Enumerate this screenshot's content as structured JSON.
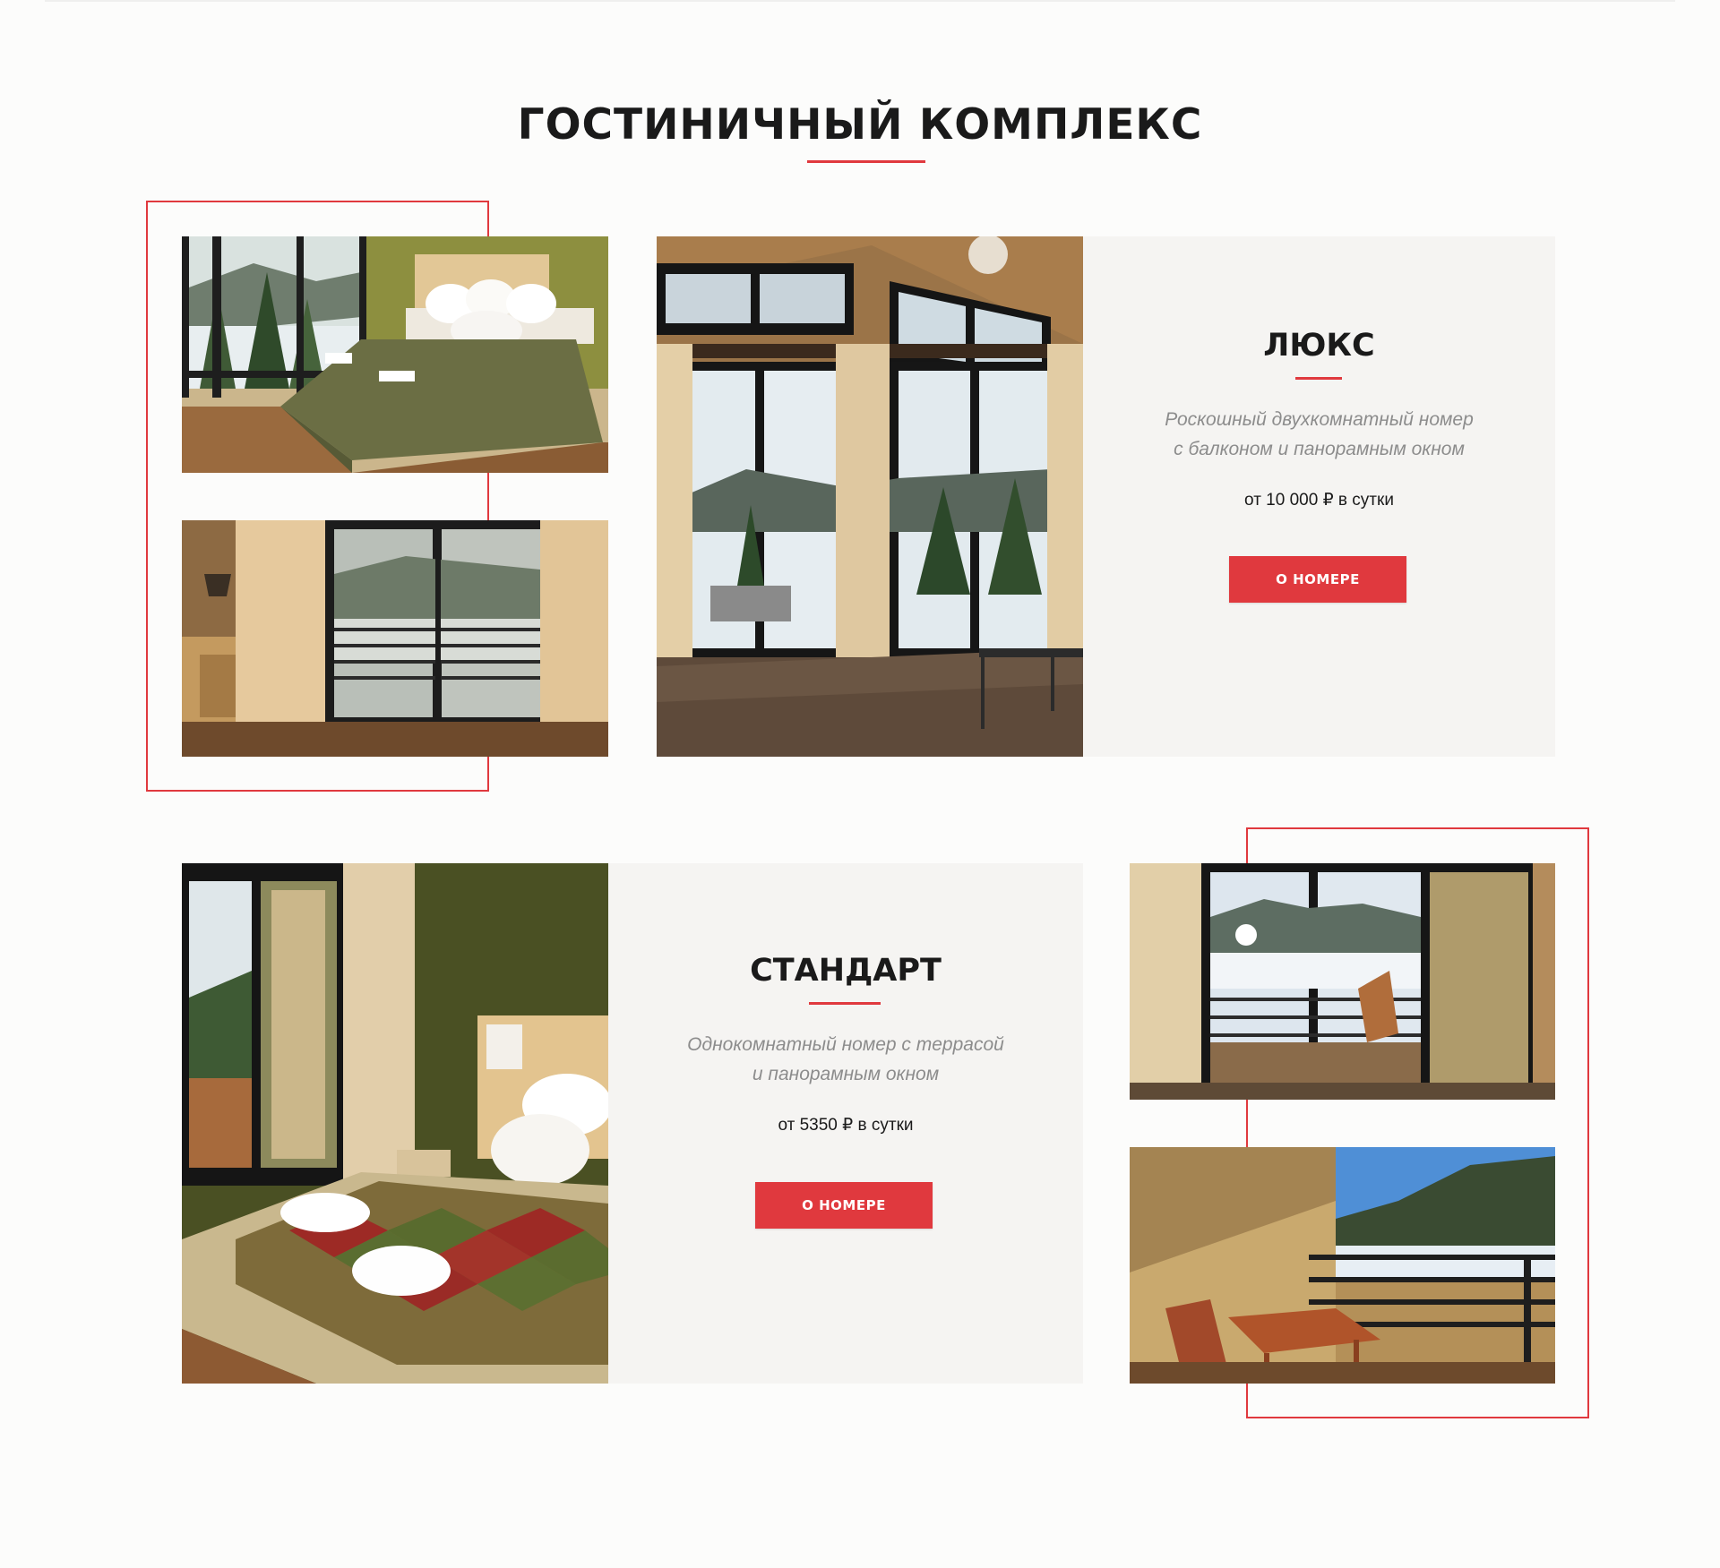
{
  "section": {
    "title": "ГОСТИНИЧНЫЙ КОМПЛЕКС"
  },
  "rooms": [
    {
      "name": "ЛЮКС",
      "description_line1": "Роскошный двухкомнатный номер",
      "description_line2": "с балконом и панорамным окном",
      "price": "от 10 000 ₽ в сутки",
      "button_label": "О НОМЕРЕ"
    },
    {
      "name": "СТАНДАРТ",
      "description_line1": "Однокомнатный номер с террасой",
      "description_line2": "и панорамным окном",
      "price": "от 5350 ₽ в сутки",
      "button_label": "О НОМЕРЕ"
    }
  ],
  "colors": {
    "accent": "#e0393e",
    "panel_bg": "#f5f4f2",
    "page_bg": "#fcfcfb"
  }
}
